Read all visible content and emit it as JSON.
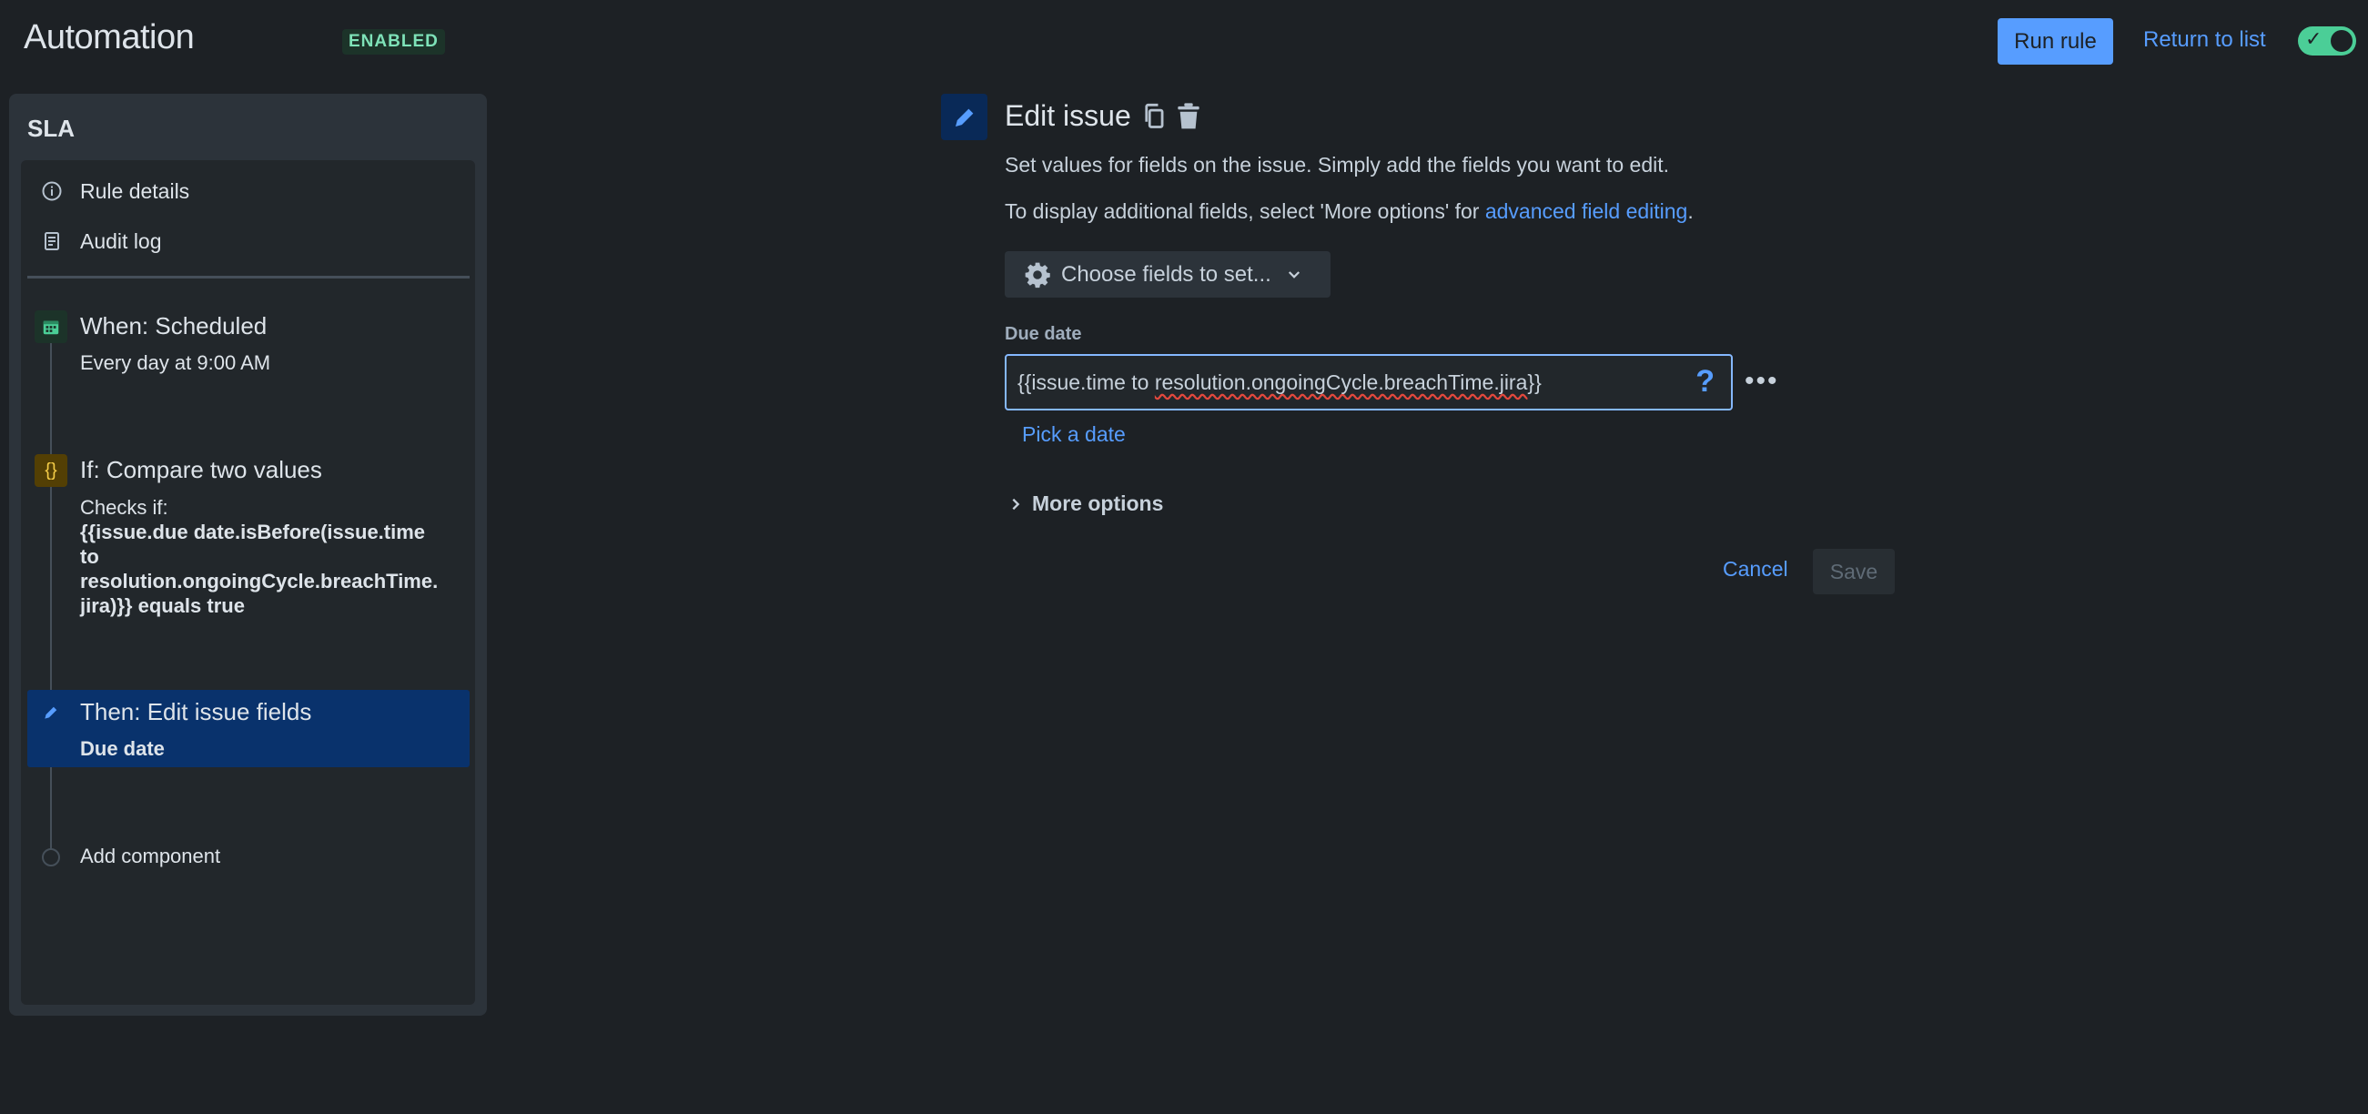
{
  "header": {
    "title": "Automation",
    "status_badge": "ENABLED",
    "run_rule": "Run rule",
    "return_to_list": "Return to list",
    "rule_enabled": true
  },
  "sidebar": {
    "rule_name": "SLA",
    "nav": [
      {
        "label": "Rule details",
        "icon": "info-icon"
      },
      {
        "label": "Audit log",
        "icon": "document-icon"
      }
    ],
    "steps": {
      "trigger": {
        "title": "When: Scheduled",
        "subtitle": "Every day at 9:00 AM",
        "icon": "calendar-icon"
      },
      "condition": {
        "title": "If: Compare two values",
        "subtitle": "Checks if:",
        "detail_lines": [
          "{{issue.due date.isBefore(issue.time",
          "to",
          "resolution.ongoingCycle.breachTime.",
          "jira)}} equals true"
        ],
        "icon": "braces-icon"
      },
      "action": {
        "title": "Then: Edit issue fields",
        "detail": "Due date",
        "icon": "pencil-icon"
      },
      "add": {
        "label": "Add component"
      }
    }
  },
  "editor": {
    "title": "Edit issue",
    "description": "Set values for fields on the issue. Simply add the fields you want to edit.",
    "description2_prefix": "To display additional fields, select 'More options' for ",
    "description2_link": "advanced field editing",
    "description2_suffix": ".",
    "choose_fields": "Choose fields to set...",
    "field_label": "Due date",
    "field_value_a": "{{issue.time to ",
    "field_value_b": "resolution.ongoingCycle.breachTime.jira",
    "field_value_c": "}}",
    "help": "?",
    "pick_date": "Pick a date",
    "more_options": "More options",
    "cancel": "Cancel",
    "save": "Save"
  },
  "colors": {
    "background": "#1d2125",
    "accent": "#579dff",
    "success": "#4bce97",
    "selected_step": "#09326c"
  }
}
